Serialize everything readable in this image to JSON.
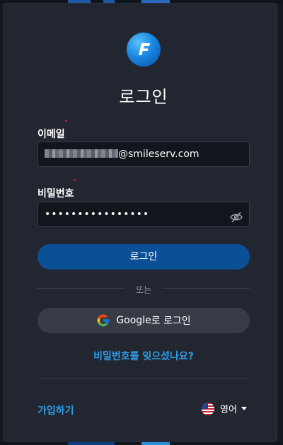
{
  "header": {
    "title": "로그인"
  },
  "form": {
    "email_label": "이메일",
    "email_value_visible": "@smileserv.com",
    "password_label": "비밀번호",
    "password_value": "••••••••••••••••"
  },
  "buttons": {
    "login": "로그인",
    "divider": "또는",
    "google_brand": "Google",
    "google_suffix": "로 로그인"
  },
  "links": {
    "forgot_password": "비밀번호를 잊으셨나요?",
    "signup": "가입하기"
  },
  "language": {
    "selected": "영어",
    "icon": "us-flag-icon"
  },
  "colors": {
    "panel_bg": "#222630",
    "primary_button": "#0b4f96",
    "link": "#2f9de6",
    "secondary_button": "#363b46"
  }
}
